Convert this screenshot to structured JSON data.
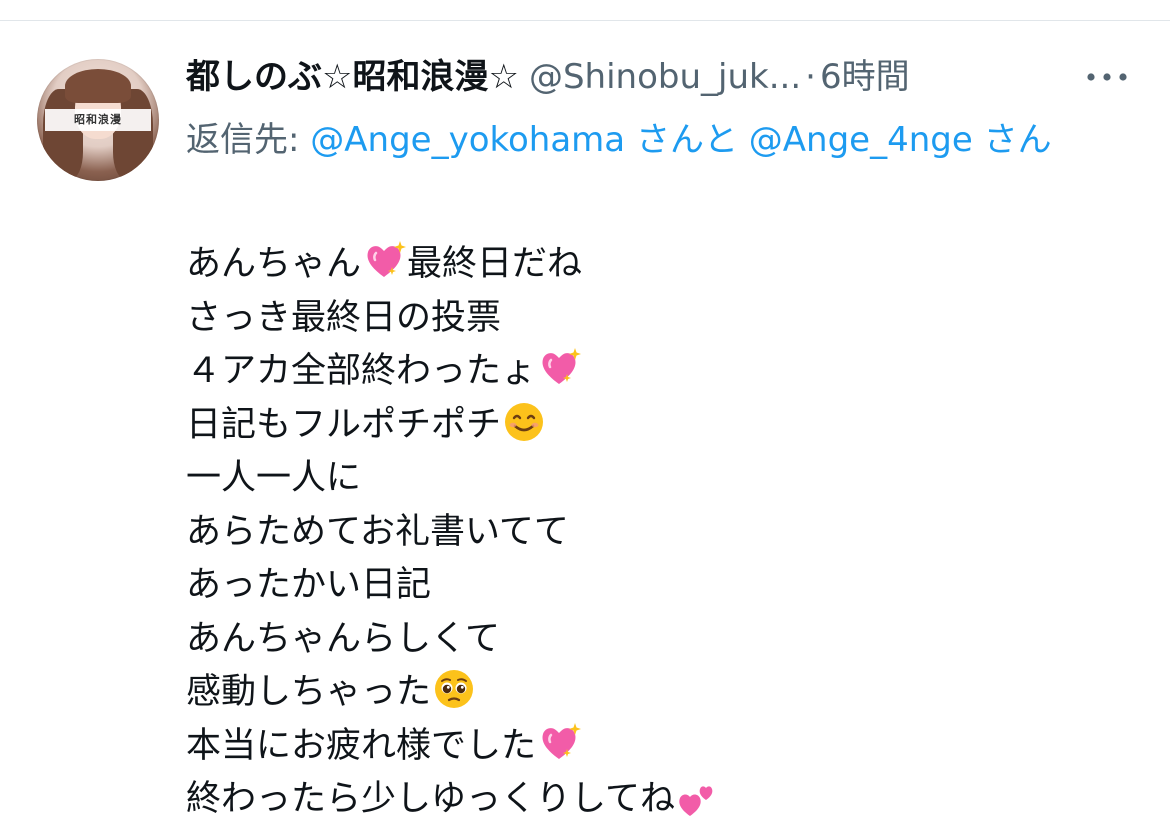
{
  "tweet": {
    "display_name": "都しのぶ☆昭和浪漫☆",
    "handle": "@Shinobu_juk...",
    "separator": "·",
    "time": "6時間",
    "avatar_caption": "昭和浪漫",
    "more_icon": "more-horizontal-icon",
    "reply": {
      "prefix": "返信先:",
      "mention1": "@Ange_yokohama",
      "joiner": "さんと",
      "mention2": "@Ange_4nge",
      "suffix": "さん"
    },
    "lines": [
      {
        "text": "あんちゃん",
        "after": "最終日だね",
        "emoji": "sparkling-heart-icon"
      },
      {
        "text": "さっき最終日の投票"
      },
      {
        "text": "４アカ全部終わったょ",
        "emoji": "sparkling-heart-icon"
      },
      {
        "text": "日記もフルポチポチ",
        "emoji": "smiling-face-icon"
      },
      {
        "text": "一人一人に"
      },
      {
        "text": "あらためてお礼書いてて"
      },
      {
        "text": "あったかい日記"
      },
      {
        "text": "あんちゃんらしくて"
      },
      {
        "text": "感動しちゃった",
        "emoji": "pleading-face-icon"
      },
      {
        "text": "本当にお疲れ様でした",
        "emoji": "sparkling-heart-icon"
      },
      {
        "text": "終わったら少しゆっくりしてね",
        "emoji": "two-hearts-icon"
      }
    ]
  },
  "colors": {
    "text": "#0f1419",
    "secondary": "#536471",
    "link": "#1d9bf0",
    "divider": "#e1e6ea",
    "heart": "#f25ca8",
    "emoji_yellow": "#fcc21b"
  }
}
